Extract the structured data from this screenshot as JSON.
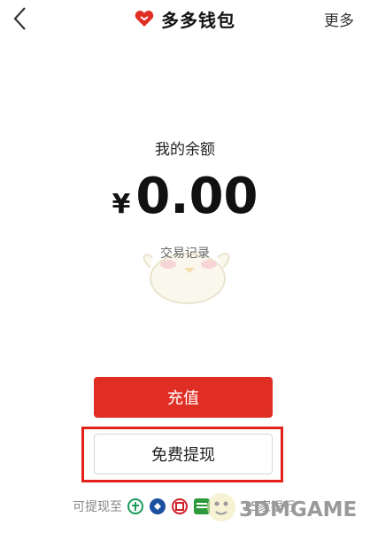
{
  "header": {
    "title": "多多钱包",
    "more_label": "更多",
    "back_icon": "chevron-left-icon",
    "logo_icon": "heart-shield-icon",
    "brand_color": "#e02e24"
  },
  "balance": {
    "label": "我的余额",
    "currency": "¥",
    "amount": "0.00",
    "transactions_link": "交易记录"
  },
  "actions": {
    "recharge_label": "充值",
    "withdraw_label": "免费提现",
    "recharge_color": "#e02e24"
  },
  "banks": {
    "prefix": "可提现至",
    "suffix": "15家银行",
    "icons": [
      "abc-bank-icon",
      "bocom-bank-icon",
      "icbc-bank-icon",
      "psbc-bank-icon"
    ]
  },
  "watermark": {
    "text": "3DMGAME"
  }
}
